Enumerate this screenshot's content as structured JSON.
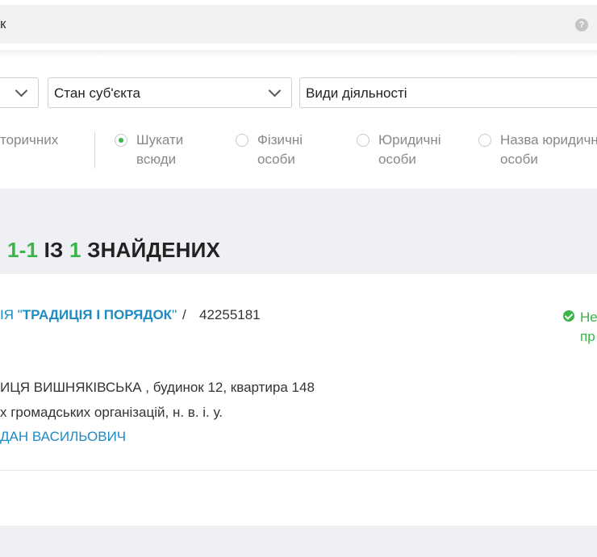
{
  "search": {
    "query": "к",
    "help": "?"
  },
  "filters": {
    "select1_label": "",
    "select2_label": "Стан суб'єкта",
    "select3_label": "Види діяльності"
  },
  "radios": {
    "partial_label": "торичних",
    "options": [
      {
        "line1": "Шукати",
        "line2": "всюди",
        "selected": true
      },
      {
        "line1": "Фізичні",
        "line2": "особи",
        "selected": false
      },
      {
        "line1": "Юридичні",
        "line2": "особи",
        "selected": false
      },
      {
        "line1": "Назва юридичн",
        "line2": "особи",
        "selected": false
      }
    ]
  },
  "results": {
    "range": "1-1",
    "of": "ІЗ",
    "total": "1",
    "found": "ЗНАЙДЕНИХ"
  },
  "card": {
    "org_prefix": "ІЯ \"",
    "org_name": "ТРАДИЦІЯ І ПОРЯДОК",
    "org_suffix": "\"",
    "slash": "/",
    "code": "42255181",
    "status_line1": "Не",
    "status_line2": "пр",
    "address": "ИЦЯ ВИШНЯКІВСЬКА , будинок 12, квартира 148",
    "activity": "х громадських організацій, н. в. і. у.",
    "person": "ДАН ВАСИЛЬОВИЧ"
  },
  "colors": {
    "accent_green": "#3bb44a",
    "link_blue": "#1e8bc3",
    "page_bg": "#eef0f3"
  }
}
